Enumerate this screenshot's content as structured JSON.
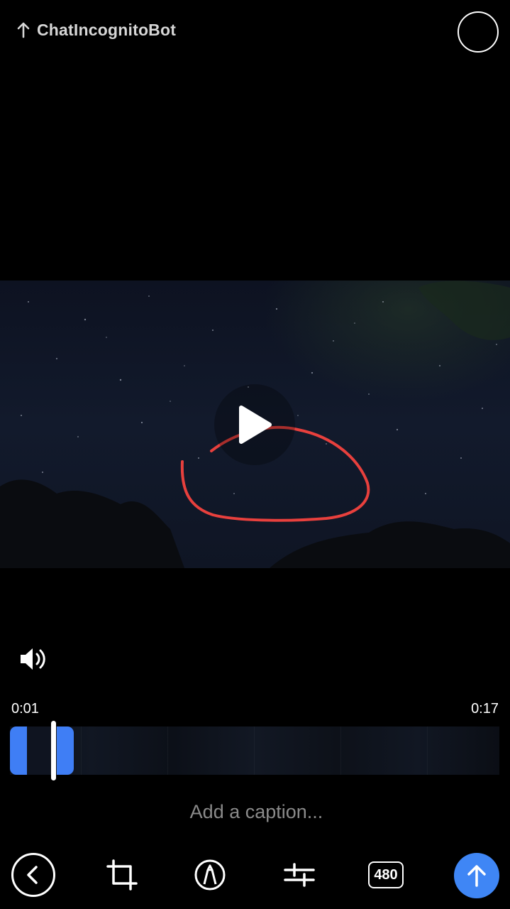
{
  "header": {
    "recipient": "ChatIncognitoBot"
  },
  "timeline": {
    "start_time": "0:01",
    "end_time": "0:17"
  },
  "caption": {
    "placeholder": "Add a caption..."
  },
  "toolbar": {
    "quality_label": "480"
  },
  "colors": {
    "accent": "#3f86f5",
    "annotation": "#e8403d",
    "background": "#000000"
  },
  "icons": [
    "up-arrow-icon",
    "select-circle-icon",
    "play-icon",
    "speaker-icon",
    "back-chevron-icon",
    "crop-icon",
    "pen-icon",
    "adjust-sliders-icon",
    "quality-badge",
    "send-arrow-icon"
  ]
}
